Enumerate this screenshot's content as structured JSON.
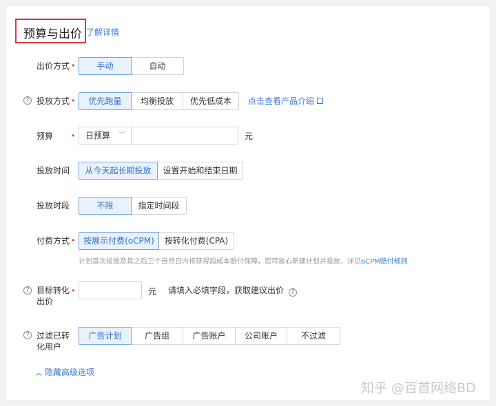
{
  "header": {
    "title": "预算与出价",
    "learn_more": "了解详情"
  },
  "bid_method": {
    "label": "出价方式",
    "required": "•",
    "options": [
      "手动",
      "自动"
    ]
  },
  "delivery_method": {
    "label": "投放方式",
    "help": "?",
    "required": "•",
    "options": [
      "优先跑量",
      "均衡投放",
      "优先低成本"
    ],
    "link": "点击查看产品介绍"
  },
  "budget": {
    "label": "预算",
    "required": "•",
    "select_value": "日预算",
    "unit": "元"
  },
  "schedule_time": {
    "label": "投放时间",
    "options": [
      "从今天起长期投放",
      "设置开始和结束日期"
    ]
  },
  "schedule_slot": {
    "label": "投放时段",
    "options": [
      "不限",
      "指定时间段"
    ]
  },
  "payment": {
    "label": "付费方式",
    "required": "•",
    "options": [
      "按展示付费(oCPM)",
      "按转化付费(CPA)"
    ],
    "hint_text": "计划首次投放及其之后三个自然日内将获得超成本赔付保障，您可放心新建计划并投放，详见",
    "hint_link": "oCPM赔付规则"
  },
  "target_bid": {
    "label_line1": "目标转化",
    "label_line2": "出价",
    "help": "?",
    "required": "•",
    "unit": "元",
    "hint": "请填入必填字段，获取建议出价"
  },
  "filter": {
    "label_line1": "过滤已转",
    "label_line2": "化用户",
    "help": "?",
    "options": [
      "广告计划",
      "广告组",
      "广告账户",
      "公司账户",
      "不过滤"
    ]
  },
  "advanced": {
    "toggle": "隐藏高级选项"
  },
  "watermark": "知乎 @百首网络BD",
  "colors": {
    "accent": "#3a7ad8",
    "active_bg": "#e9f2fc",
    "required": "#e0353b",
    "highlight_box": "#d9383f"
  }
}
